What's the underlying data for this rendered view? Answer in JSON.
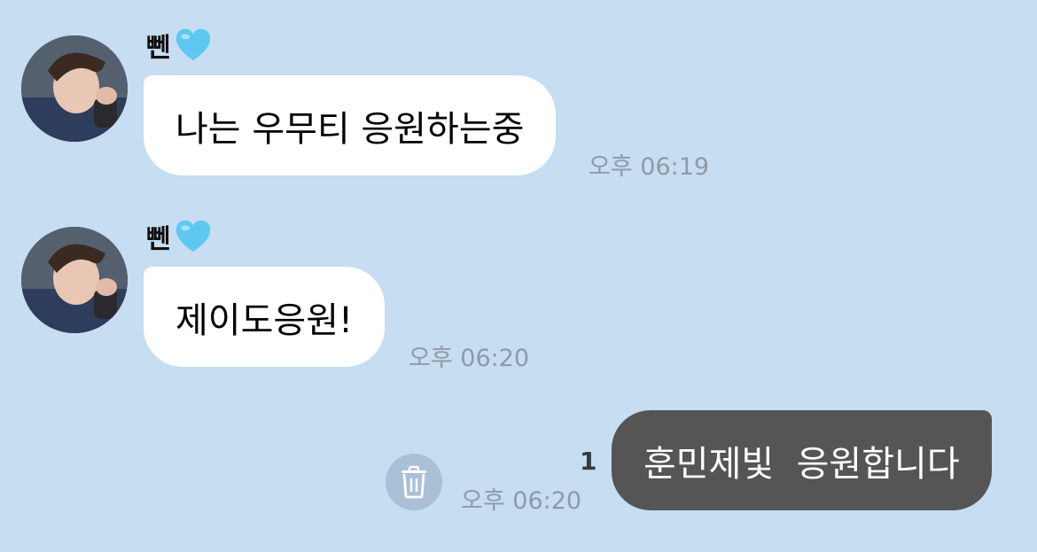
{
  "colors": {
    "background": "#c6ddf2",
    "incoming_bubble": "#ffffff",
    "outgoing_bubble": "#555555",
    "timestamp": "#8f9aa6",
    "heart": "#5ec8f2"
  },
  "messages": [
    {
      "sender": "뻰",
      "sender_emoji": "light-blue-heart-icon",
      "text": "나는 우무티 응원하는중",
      "time": "오후 06:19"
    },
    {
      "sender": "뻰",
      "sender_emoji": "light-blue-heart-icon",
      "text": "제이도응원!",
      "time": "오후 06:20"
    },
    {
      "text": "훈민제빛  응원합니다",
      "time": "오후 06:20",
      "unread_count": "1"
    }
  ]
}
